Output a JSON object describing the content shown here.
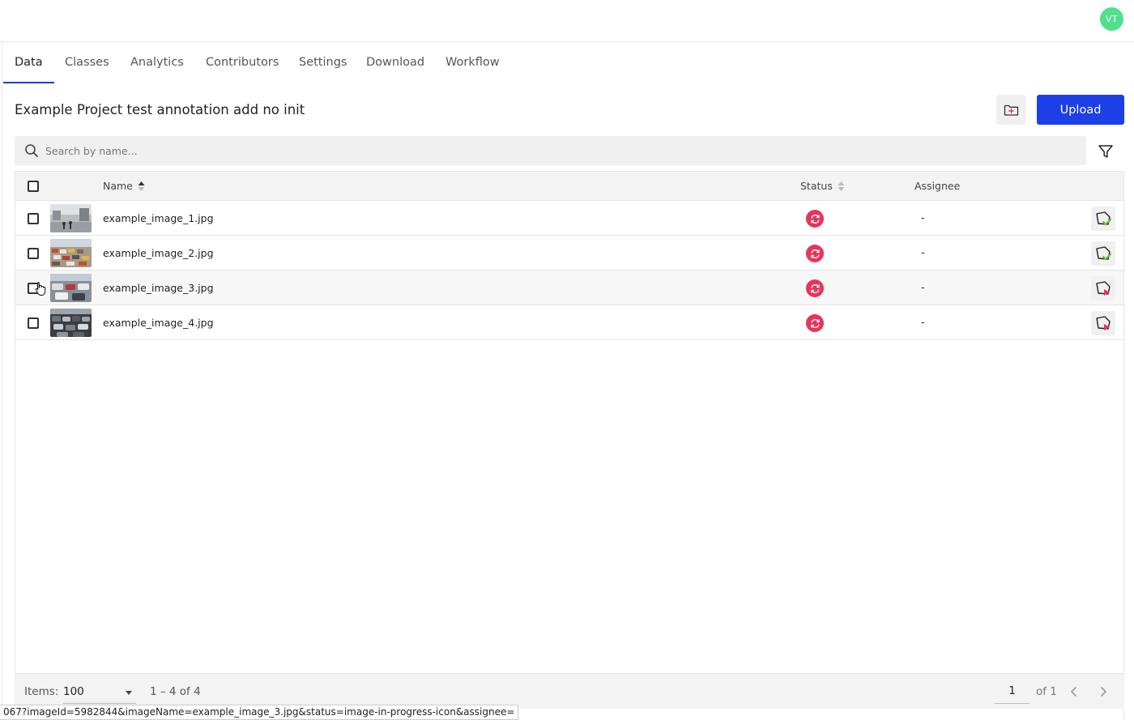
{
  "user": {
    "initials": "VT",
    "avatar_color": "#4fe08c"
  },
  "tabs": [
    {
      "label": "Data",
      "active": true
    },
    {
      "label": "Classes",
      "active": false
    },
    {
      "label": "Analytics",
      "active": false
    },
    {
      "label": "Contributors",
      "active": false
    },
    {
      "label": "Settings",
      "active": false
    },
    {
      "label": "Download",
      "active": false
    },
    {
      "label": "Workflow",
      "active": false
    }
  ],
  "project": {
    "title": "Example Project test annotation add no init"
  },
  "toolbar": {
    "upload_label": "Upload",
    "new_folder_icon": "folder-plus-icon"
  },
  "search": {
    "placeholder": "Search by name...",
    "value": ""
  },
  "table": {
    "columns": {
      "name": "Name",
      "status": "Status",
      "assignee": "Assignee"
    },
    "rows": [
      {
        "name": "example_image_1.jpg",
        "status": "image-in-progress-icon",
        "assignee": "-",
        "action": "annotation-completed-icon"
      },
      {
        "name": "example_image_2.jpg",
        "status": "image-in-progress-icon",
        "assignee": "-",
        "action": "annotation-completed-icon"
      },
      {
        "name": "example_image_3.jpg",
        "status": "image-in-progress-icon",
        "assignee": "-",
        "action": "start-annotation-icon"
      },
      {
        "name": "example_image_4.jpg",
        "status": "image-in-progress-icon",
        "assignee": "-",
        "action": "start-annotation-icon"
      }
    ]
  },
  "footer": {
    "items_label": "Items:",
    "items_per_page": "100",
    "range": "1 – 4 of 4",
    "page": "1",
    "of_pages": "of 1"
  },
  "status_bar": {
    "url": "067?imageId=5982844&imageName=example_image_3.jpg&status=image-in-progress-icon&assignee="
  },
  "colors": {
    "accent": "#1d3fe8",
    "status_in_progress": "#e8345a",
    "complete": "#6dbf3c"
  }
}
